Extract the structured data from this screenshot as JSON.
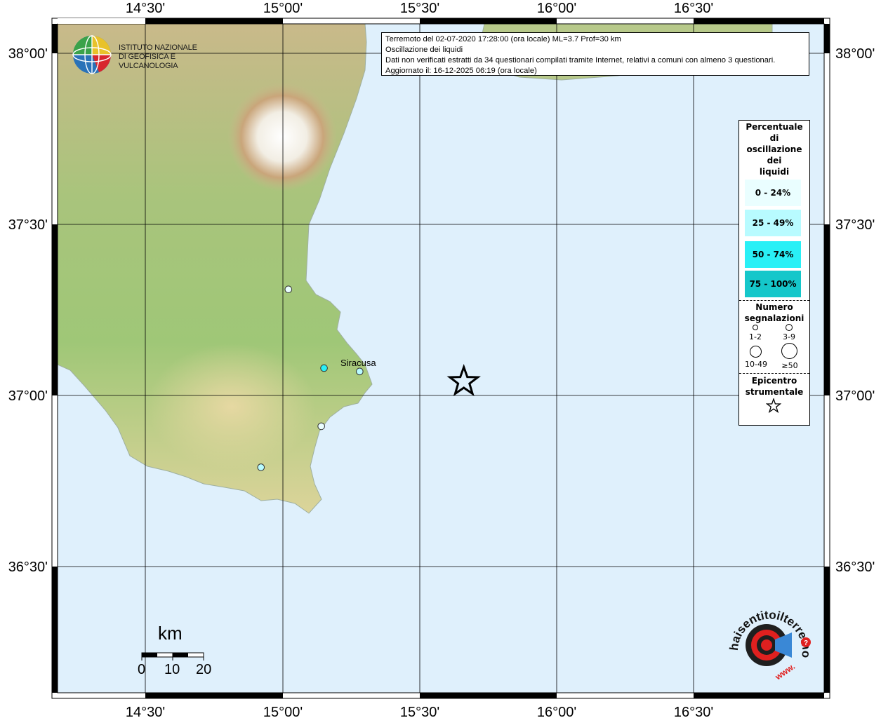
{
  "axes": {
    "lon_labels": [
      "14°30'",
      "15°00'",
      "15°30'",
      "16°00'",
      "16°30'"
    ],
    "lat_labels": [
      "38°00'",
      "37°30'",
      "37°00'",
      "36°30'"
    ],
    "lon_range": [
      14.2,
      17.0
    ],
    "lat_range": [
      36.2,
      38.1
    ]
  },
  "info": {
    "line1": "Terremoto del 02-07-2020 17:28:00 (ora locale) ML=3.7 Prof=30 km",
    "line2": "Oscillazione dei liquidi",
    "line3": "Dati non verificati estratti da 34 questionari compilati tramite Internet, relativi a comuni con almeno 3 questionari.",
    "line4": "Aggiornato il: 16-12-2025 06:19 (ora locale)"
  },
  "logo": {
    "line1": "ISTITUTO NAZIONALE",
    "line2": "DI GEOFISICA E VULCANOLOGIA"
  },
  "legend": {
    "title_lines": [
      "Percentuale",
      "di",
      "oscillazione",
      "dei",
      "liquidi"
    ],
    "ranges": [
      {
        "label": "0 - 24%",
        "color": "#eafeff"
      },
      {
        "label": "25 - 49%",
        "color": "#b8fbff"
      },
      {
        "label": "50 - 74%",
        "color": "#29f0f6"
      },
      {
        "label": "75 - 100%",
        "color": "#15c7ca"
      }
    ],
    "count_title_lines": [
      "Numero",
      "segnalazioni"
    ],
    "count_labels": [
      "1-2",
      "3-9",
      "10-49",
      "≥50"
    ],
    "epicenter_title_lines": [
      "Epicentro",
      "strumentale"
    ]
  },
  "map": {
    "city": "Siracusa",
    "epicenter": {
      "lon": 15.66,
      "lat": 37.04
    },
    "observations": [
      {
        "lon": 15.15,
        "lat": 37.08,
        "color": "#29f0f6",
        "count_class": "1-2"
      },
      {
        "lon": 15.28,
        "lat": 37.07,
        "color": "#b8fbff",
        "count_class": "1-2"
      },
      {
        "lon": 15.14,
        "lat": 36.91,
        "color": "#eafeff",
        "count_class": "1-2"
      },
      {
        "lon": 14.92,
        "lat": 36.79,
        "color": "#b8fbff",
        "count_class": "1-2"
      },
      {
        "lon": 15.02,
        "lat": 37.31,
        "color": "#eafeff",
        "count_class": "1-2"
      }
    ],
    "sea_color": "#dff0fc"
  },
  "scale": {
    "unit": "km",
    "ticks": [
      "0",
      "10",
      "20"
    ]
  },
  "watermark": {
    "text": "haisentitoilterremoto.it",
    "url_text": "www."
  }
}
